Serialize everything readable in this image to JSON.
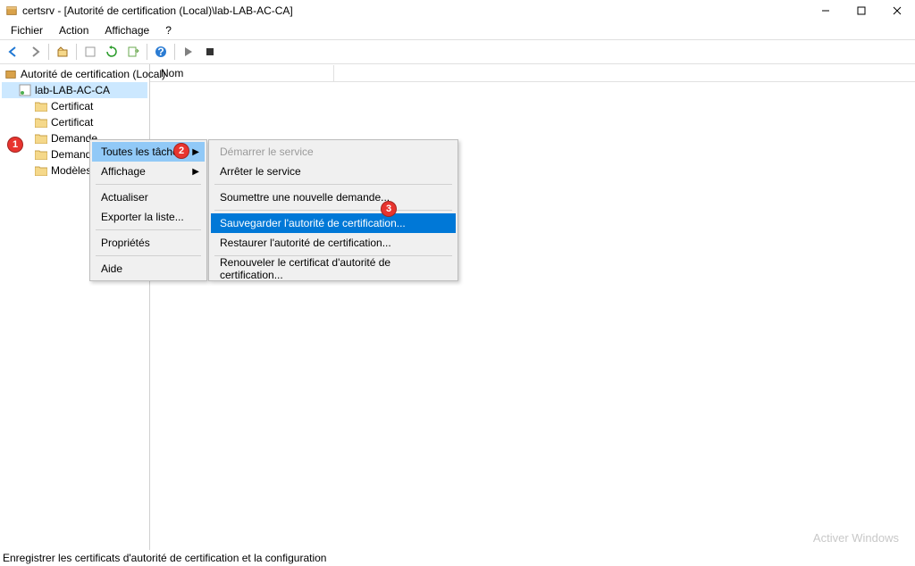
{
  "window": {
    "title": "certsrv - [Autorité de certification (Local)\\lab-LAB-AC-CA]"
  },
  "menu": {
    "file": "Fichier",
    "action": "Action",
    "view": "Affichage",
    "help": "?"
  },
  "tree": {
    "root": "Autorité de certification (Local)",
    "ca": "lab-LAB-AC-CA",
    "children": [
      "Certificat",
      "Certificat",
      "Demande",
      "Demande",
      "Modèles"
    ]
  },
  "column_header": "Nom",
  "ctx1": {
    "all_tasks": "Toutes les tâches",
    "view": "Affichage",
    "refresh": "Actualiser",
    "export": "Exporter la liste...",
    "properties": "Propriétés",
    "help": "Aide"
  },
  "ctx2": {
    "start": "Démarrer le service",
    "stop": "Arrêter le service",
    "submit": "Soumettre une nouvelle demande...",
    "backup": "Sauvegarder l'autorité de certification...",
    "restore": "Restaurer l'autorité de certification...",
    "renew": "Renouveler le certificat d'autorité de certification..."
  },
  "badges": {
    "b1": "1",
    "b2": "2",
    "b3": "3"
  },
  "status": "Enregistrer les certificats d'autorité de certification et la configuration",
  "watermark": "Activer Windows"
}
